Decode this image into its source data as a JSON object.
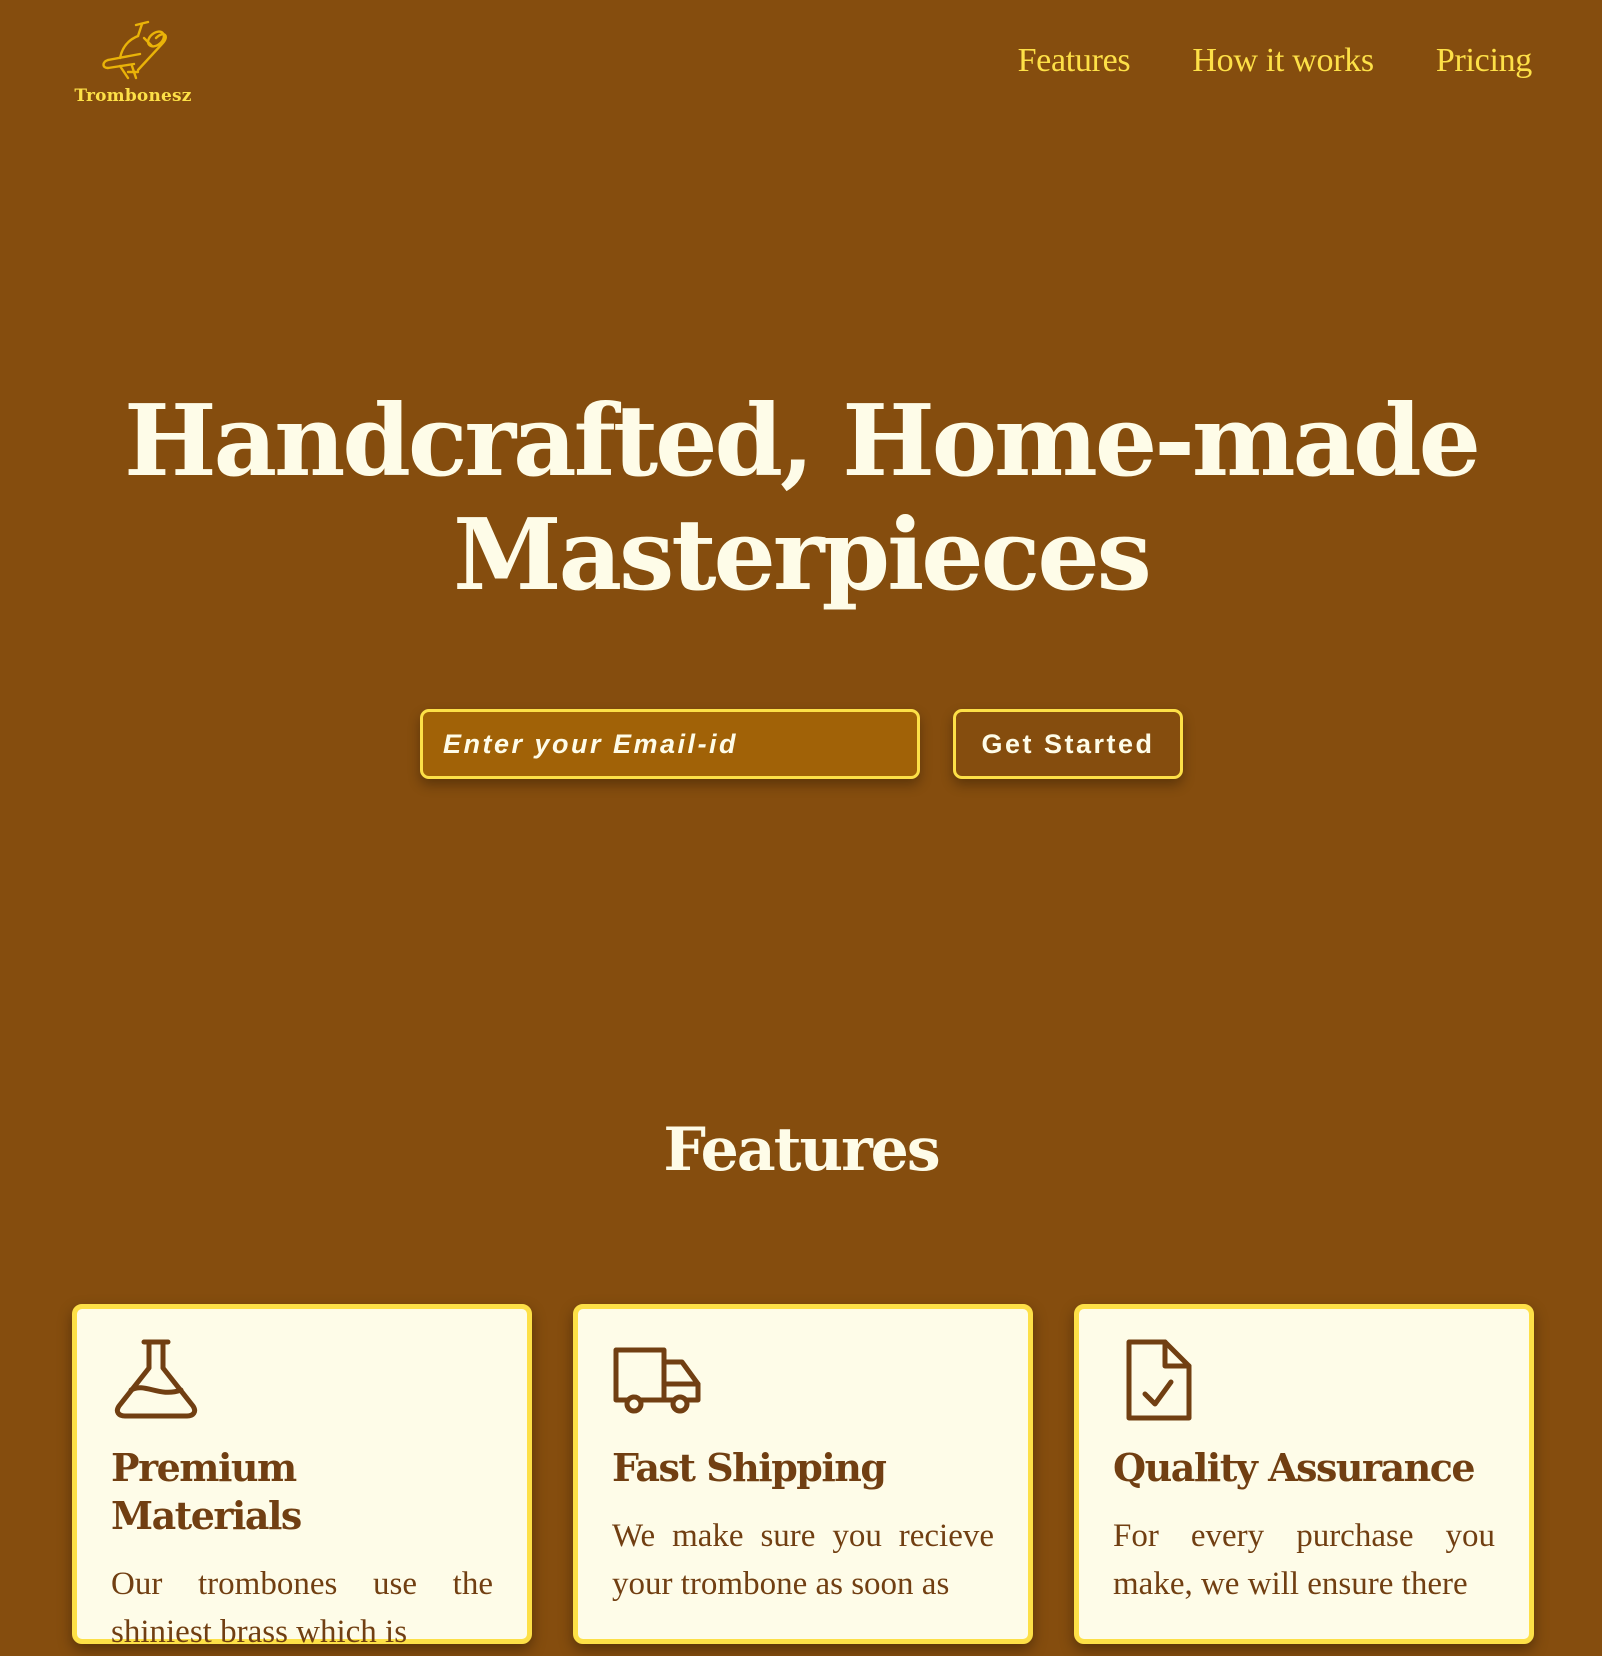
{
  "brand": {
    "name": "Trombonesz",
    "logo_icon": "trombone-icon"
  },
  "nav": {
    "links": [
      "Features",
      "How it works",
      "Pricing"
    ]
  },
  "hero": {
    "title_line1": "Handcrafted, Home-made",
    "title_line2": "Masterpieces",
    "email_placeholder": "Enter your Email-id",
    "cta_label": "Get Started"
  },
  "features": {
    "heading": "Features",
    "cards": [
      {
        "icon": "flask-icon",
        "title": "Premium Materials",
        "text": "Our trombones use the shiniest brass which is"
      },
      {
        "icon": "truck-icon",
        "title": "Fast Shipping",
        "text": "We make sure you recieve your trombone as soon as"
      },
      {
        "icon": "file-check-icon",
        "title": "Quality Assurance",
        "text": "For every purchase you make, we will ensure there"
      }
    ]
  },
  "colors": {
    "background": "#854d0e",
    "accent": "#fde047",
    "light": "#fefce8",
    "dark_text": "#713f12",
    "input_bg": "#a16207"
  }
}
